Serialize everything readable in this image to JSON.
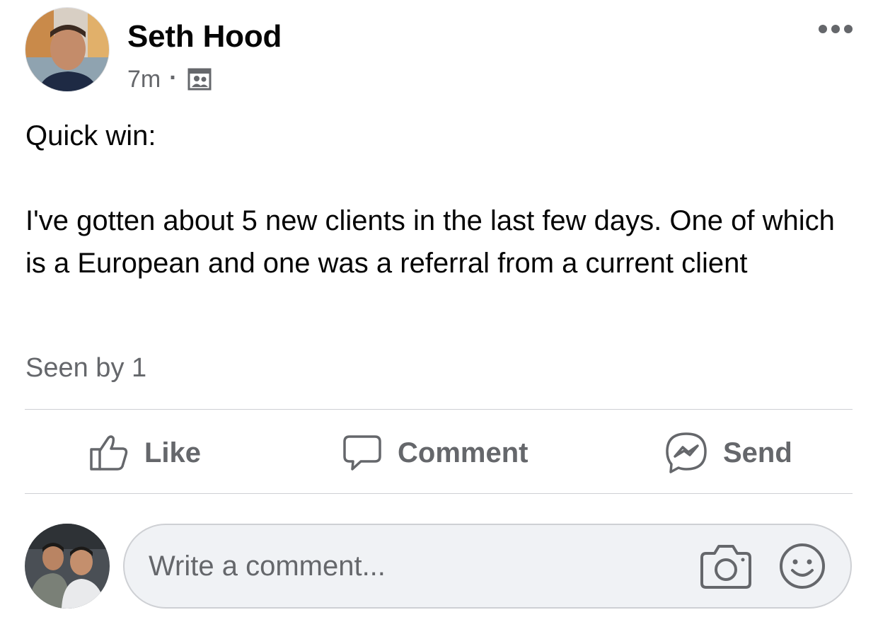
{
  "post": {
    "author_name": "Seth Hood",
    "timestamp": "7m",
    "separator": "·",
    "audience_icon": "group-audience-icon",
    "more_icon": "more-options-icon",
    "body_lines": [
      "Quick win:",
      "I've gotten about 5 new clients in the last few days. One of which is a European and one was a referral from a current client"
    ],
    "seen_by": "Seen by 1"
  },
  "actions": {
    "like_label": "Like",
    "like_icon": "thumbs-up-icon",
    "comment_label": "Comment",
    "comment_icon": "comment-bubble-icon",
    "send_label": "Send",
    "send_icon": "messenger-icon"
  },
  "composer": {
    "placeholder": "Write a comment...",
    "value": "",
    "camera_icon": "camera-icon",
    "emoji_icon": "emoji-smile-icon"
  },
  "colors": {
    "text_primary": "#050505",
    "text_secondary": "#65676b",
    "divider": "#ced0d4",
    "input_background": "#f0f2f5"
  }
}
